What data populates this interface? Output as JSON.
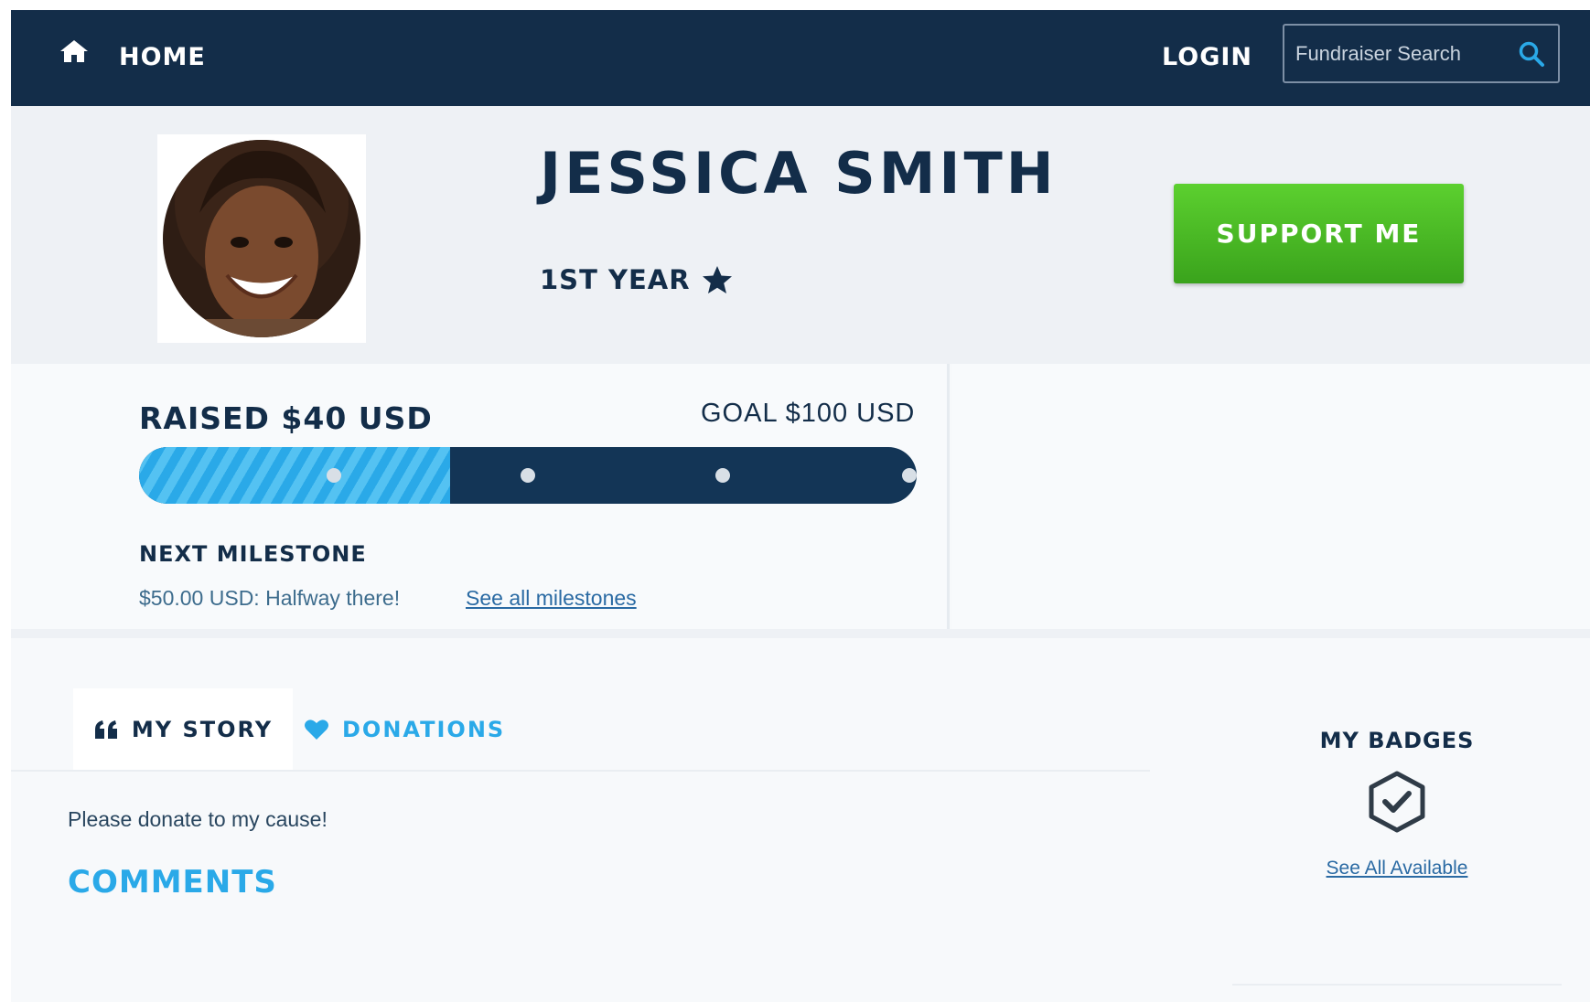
{
  "header": {
    "home_label": "HOME",
    "login_label": "LOGIN",
    "search_placeholder": "Fundraiser Search",
    "home_icon": "home-icon",
    "search_icon": "search-icon"
  },
  "profile": {
    "name": "JESSICA SMITH",
    "year_label": "1ST YEAR",
    "year_icon": "star-icon",
    "support_label": "SUPPORT ME"
  },
  "progress": {
    "raised_label": "RAISED $40 USD",
    "goal_label": "GOAL $100 USD",
    "raised_fraction": 0.4,
    "milestone_fractions": [
      0.25,
      0.5,
      0.75,
      1.0
    ],
    "next_milestone_heading": "NEXT MILESTONE",
    "next_milestone_text": "$50.00 USD: Halfway there!",
    "milestones_link": "See all milestones"
  },
  "tabs": [
    {
      "label": "MY STORY",
      "icon": "quote-icon",
      "active": true
    },
    {
      "label": "DONATIONS",
      "icon": "heart-icon",
      "active": false
    }
  ],
  "story": {
    "text": "Please donate to my cause!",
    "comments_heading": "COMMENTS"
  },
  "badges": {
    "title": "MY BADGES",
    "icon": "hexagon-check-icon",
    "link": "See All Available"
  },
  "colors": {
    "navy": "#132d49",
    "accent_blue": "#2aa9e8",
    "support_green": "#47b826"
  }
}
